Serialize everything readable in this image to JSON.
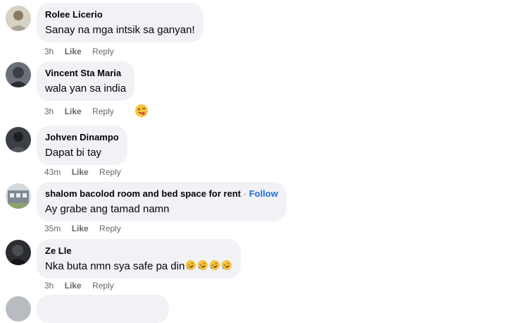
{
  "comments": [
    {
      "author": "Rolee Licerio",
      "text": "Sanay na mga intsik sa ganyan!",
      "time": "3h",
      "like": "Like",
      "reply": "Reply"
    },
    {
      "author": "Vincent Sta Maria",
      "text": "wala yan sa india",
      "time": "3h",
      "like": "Like",
      "reply": "Reply",
      "reaction_icon": "yum-face-emoji"
    },
    {
      "author": "Johven Dinampo",
      "text": "Dapat bi tay",
      "time": "43m",
      "like": "Like",
      "reply": "Reply"
    },
    {
      "author": "shalom bacolod room and bed space for rent",
      "separator": "·",
      "follow": "Follow",
      "text": "Ay grabe ang tamad namn",
      "time": "35m",
      "like": "Like",
      "reply": "Reply"
    },
    {
      "author": "Ze Lle",
      "text": "Nka buta nmn sya safe pa din",
      "text_emoji": "rolling-on-floor-laughing-emoji",
      "emoji_count": 4,
      "time": "3h",
      "like": "Like",
      "reply": "Reply"
    }
  ],
  "colors": {
    "bubble": "#f0f2f5",
    "meta": "#65676b",
    "follow": "#216fdb",
    "text": "#050505"
  }
}
